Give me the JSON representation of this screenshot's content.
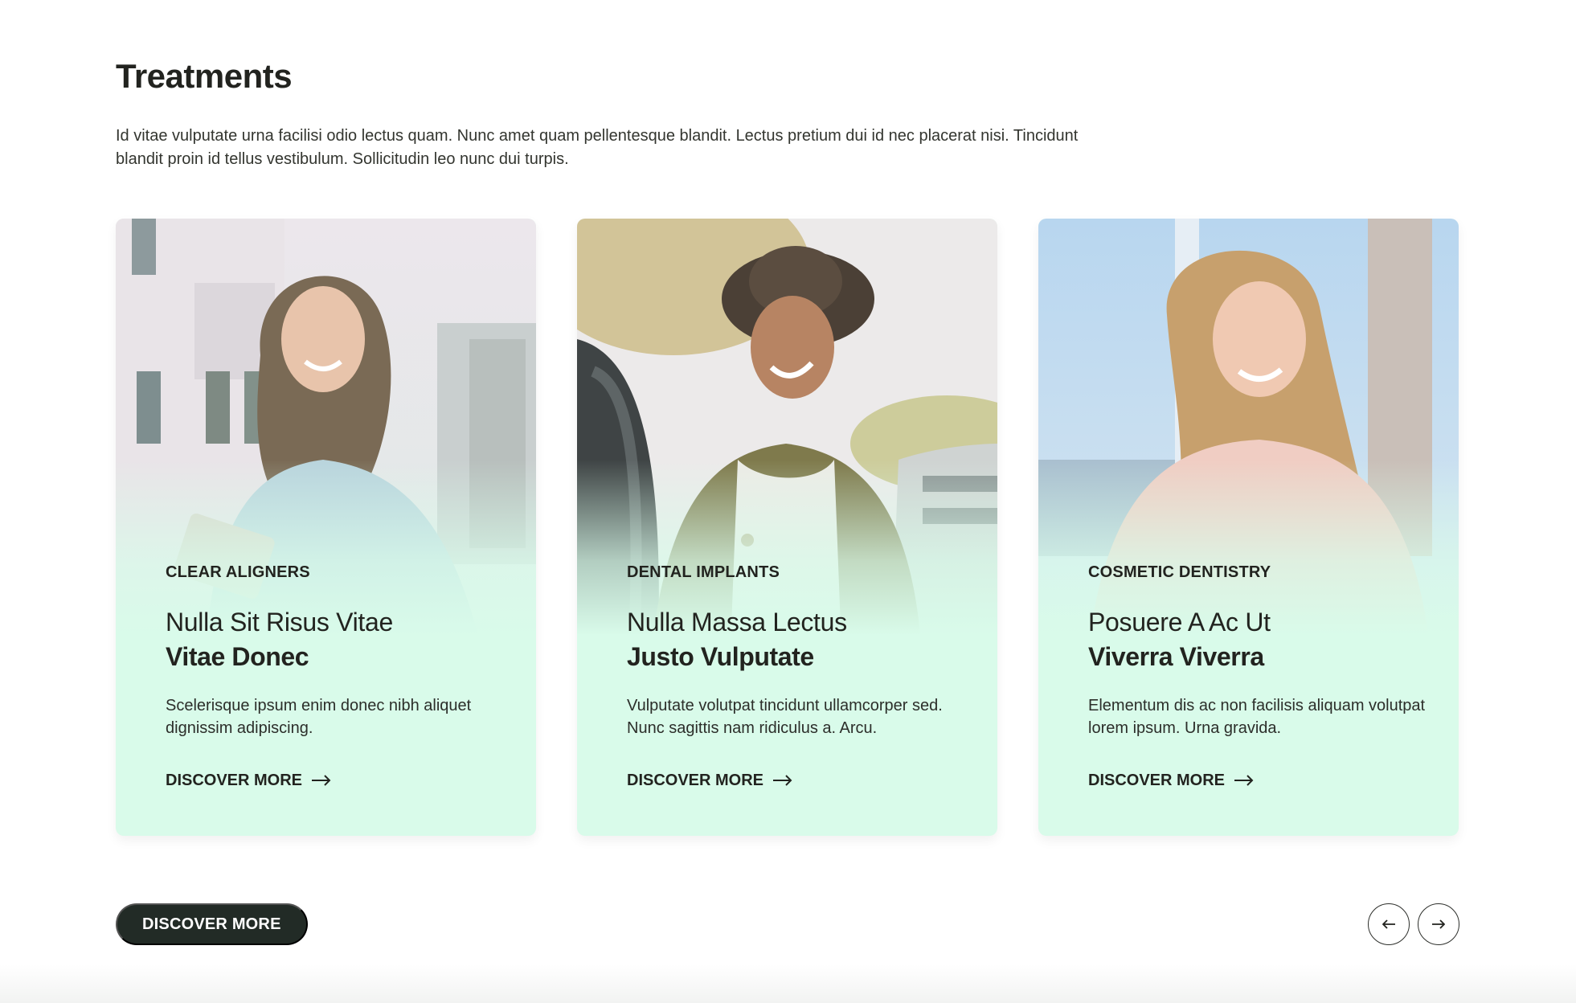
{
  "section": {
    "title": "Treatments",
    "intro": "Id vitae vulputate urna facilisi odio lectus quam. Nunc amet quam pellentesque blandit. Lectus pretium dui id nec placerat nisi. Tincidunt blandit proin id tellus vestibulum. Sollicitudin leo nunc dui turpis."
  },
  "cards": [
    {
      "category": "CLEAR ALIGNERS",
      "headline_light": "Nulla Sit Risus Vitae",
      "headline_bold": "Vitae Donec",
      "description": "Scelerisque ipsum enim donec nibh aliquet dignissim adipiscing.",
      "link_label": "DISCOVER MORE"
    },
    {
      "category": "DENTAL IMPLANTS",
      "headline_light": "Nulla Massa Lectus",
      "headline_bold": "Justo Vulputate",
      "description": "Vulputate volutpat tincidunt ullamcorper sed. Nunc sagittis nam ridiculus a. Arcu.",
      "link_label": "DISCOVER MORE"
    },
    {
      "category": "COSMETIC DENTISTRY",
      "headline_light": "Posuere A Ac Ut",
      "headline_bold": "Viverra Viverra",
      "description": "Elementum dis ac non facilisis aliquam volutpat lorem ipsum. Urna gravida.",
      "link_label": "DISCOVER MORE"
    }
  ],
  "footer": {
    "cta_label": "DISCOVER MORE",
    "prev_icon": "arrow-left-icon",
    "next_icon": "arrow-right-icon"
  },
  "colors": {
    "card_background": "#d9fbea",
    "cta_background": "#222b26",
    "text": "#22231f"
  }
}
